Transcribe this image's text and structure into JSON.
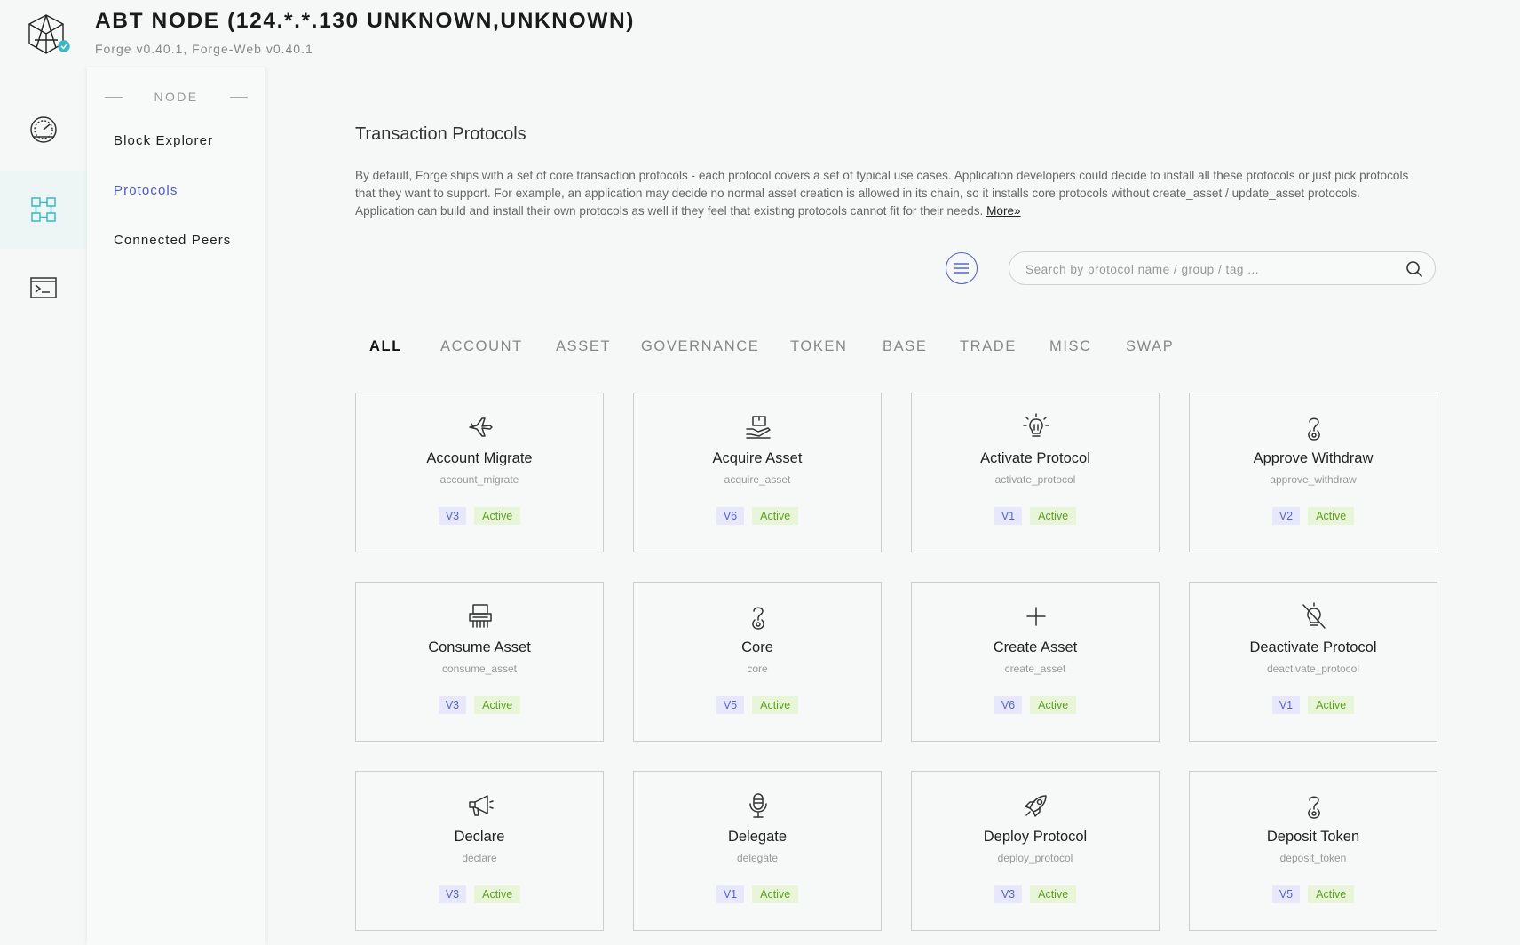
{
  "header": {
    "title": "ABT NODE (124.*.*.130 UNKNOWN,UNKNOWN)",
    "subtitle": "Forge v0.40.1, Forge-Web v0.40.1",
    "logo_icon": "cube-logo-icon"
  },
  "rail": {
    "items": [
      {
        "icon": "dashboard-gauge-icon",
        "active": false
      },
      {
        "icon": "node-grid-icon",
        "active": true
      },
      {
        "icon": "terminal-icon",
        "active": false
      }
    ]
  },
  "subnav": {
    "header": "NODE",
    "links": [
      {
        "label": "Block Explorer",
        "active": false
      },
      {
        "label": "Protocols",
        "active": true
      },
      {
        "label": "Connected Peers",
        "active": false
      }
    ]
  },
  "main": {
    "title": "Transaction Protocols",
    "description": "By default, Forge ships with a set of core transaction protocols - each protocol covers a set of typical use cases. Application developers could decide to install all these protocols or just pick protocols that they want to support. For example, an application may decide no normal asset creation is allowed in its chain, so it installs core protocols without create_asset / update_asset protocols. Application can build and install their own protocols as well if they feel that existing protocols cannot fit for their needs.",
    "more_link": "More»",
    "search_placeholder": "Search by protocol name / group / tag ...",
    "tabs": [
      "ALL",
      "ACCOUNT",
      "ASSET",
      "GOVERNANCE",
      "TOKEN",
      "BASE",
      "TRADE",
      "MISC",
      "SWAP"
    ],
    "active_tab": "ALL",
    "protocols": [
      {
        "name": "Account Migrate",
        "slug": "account_migrate",
        "version": "V3",
        "status": "Active",
        "icon": "airplane-icon"
      },
      {
        "name": "Acquire Asset",
        "slug": "acquire_asset",
        "version": "V6",
        "status": "Active",
        "icon": "hand-package-icon"
      },
      {
        "name": "Activate Protocol",
        "slug": "activate_protocol",
        "version": "V1",
        "status": "Active",
        "icon": "lightbulb-icon"
      },
      {
        "name": "Approve Withdraw",
        "slug": "approve_withdraw",
        "version": "V2",
        "status": "Active",
        "icon": "question-icon"
      },
      {
        "name": "Consume Asset",
        "slug": "consume_asset",
        "version": "V3",
        "status": "Active",
        "icon": "shredder-icon"
      },
      {
        "name": "Core",
        "slug": "core",
        "version": "V5",
        "status": "Active",
        "icon": "question-icon"
      },
      {
        "name": "Create Asset",
        "slug": "create_asset",
        "version": "V6",
        "status": "Active",
        "icon": "plus-icon"
      },
      {
        "name": "Deactivate Protocol",
        "slug": "deactivate_protocol",
        "version": "V1",
        "status": "Active",
        "icon": "lightbulb-off-icon"
      },
      {
        "name": "Declare",
        "slug": "declare",
        "version": "V3",
        "status": "Active",
        "icon": "megaphone-icon"
      },
      {
        "name": "Delegate",
        "slug": "delegate",
        "version": "V1",
        "status": "Active",
        "icon": "microphone-icon"
      },
      {
        "name": "Deploy Protocol",
        "slug": "deploy_protocol",
        "version": "V3",
        "status": "Active",
        "icon": "rocket-icon"
      },
      {
        "name": "Deposit Token",
        "slug": "deposit_token",
        "version": "V5",
        "status": "Active",
        "icon": "question-icon"
      }
    ]
  },
  "colors": {
    "accent": "#4a5bd8",
    "teal": "#3bb8c4",
    "version_badge_bg": "#e7e8fb",
    "version_badge_text": "#5563d8",
    "status_badge_bg": "#e8f5d9",
    "status_badge_text": "#5da020"
  }
}
